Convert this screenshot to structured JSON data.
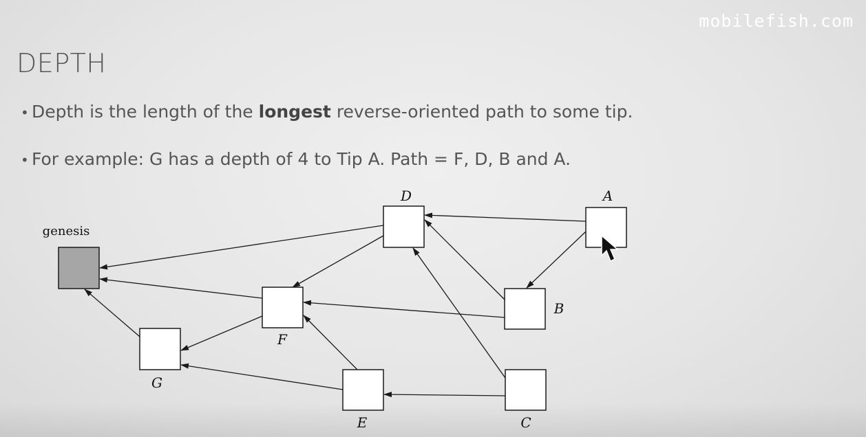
{
  "watermark": "mobilefish.com",
  "title": "DEPTH",
  "bullets": [
    {
      "before": "Depth is the length of the ",
      "bold": "longest",
      "after": " reverse-oriented path to some tip."
    },
    {
      "text": "For example: G has a depth of 4 to Tip A. Path = F, D, B and A."
    }
  ],
  "diagram": {
    "genesis_label": "genesis",
    "nodes": [
      {
        "id": "D",
        "label": "D"
      },
      {
        "id": "A",
        "label": "A"
      },
      {
        "id": "B",
        "label": "B"
      },
      {
        "id": "F",
        "label": "F"
      },
      {
        "id": "G",
        "label": "G"
      },
      {
        "id": "E",
        "label": "E"
      },
      {
        "id": "C",
        "label": "C"
      }
    ],
    "edges": [
      {
        "from": "A",
        "to": "D"
      },
      {
        "from": "A",
        "to": "B"
      },
      {
        "from": "B",
        "to": "D"
      },
      {
        "from": "B",
        "to": "F"
      },
      {
        "from": "C",
        "to": "D"
      },
      {
        "from": "C",
        "to": "E"
      },
      {
        "from": "D",
        "to": "F"
      },
      {
        "from": "D",
        "to": "genesis"
      },
      {
        "from": "F",
        "to": "genesis"
      },
      {
        "from": "F",
        "to": "G"
      },
      {
        "from": "E",
        "to": "F"
      },
      {
        "from": "E",
        "to": "G"
      },
      {
        "from": "G",
        "to": "genesis"
      }
    ],
    "colors": {
      "genesis_fill": "#a6a6a6",
      "node_fill": "#ffffff",
      "stroke": "#1a1a1a"
    }
  }
}
